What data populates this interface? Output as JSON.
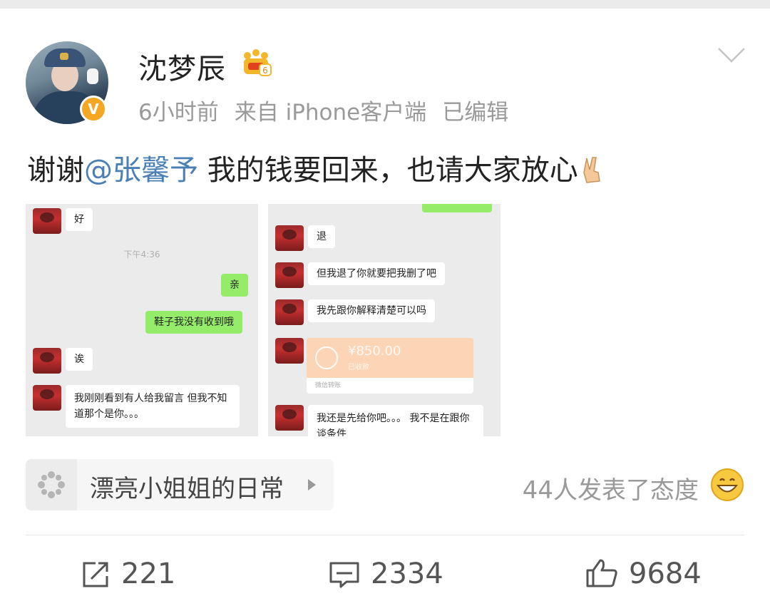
{
  "post": {
    "username": "沈梦辰",
    "time": "6小时前",
    "source": "来自 iPhone客户端",
    "edited": "已编辑",
    "text_prefix": "谢谢",
    "mention": "@张馨予",
    "text_suffix": " 我的钱要回来，也请大家放心"
  },
  "screenshot_left": {
    "messages": [
      "好",
      "亲",
      "鞋子我没有收到哦",
      "诶",
      "我刚刚看到有人给我留言 但我不知道那个是你。。。"
    ],
    "time_label": "下午4:36"
  },
  "screenshot_right": {
    "messages": [
      "退",
      "但我退了你就要把我删了吧",
      "我先跟你解释清楚可以吗",
      "我还是先给你吧。。。 我不是在跟你谈条件"
    ],
    "transfer_amount": "¥850.00",
    "transfer_note": "已收款",
    "transfer_footer": "微信转账"
  },
  "topic": {
    "label": "漂亮小姐姐的日常"
  },
  "reactions": {
    "text": "44人发表了态度"
  },
  "actions": {
    "share_count": "221",
    "comment_count": "2334",
    "like_count": "9684"
  },
  "icons": [
    "crown-level-icon",
    "chevron-down-icon",
    "victory-hand-emoji",
    "topic-icon",
    "grin-emoji",
    "share-icon",
    "comment-icon",
    "like-icon"
  ]
}
